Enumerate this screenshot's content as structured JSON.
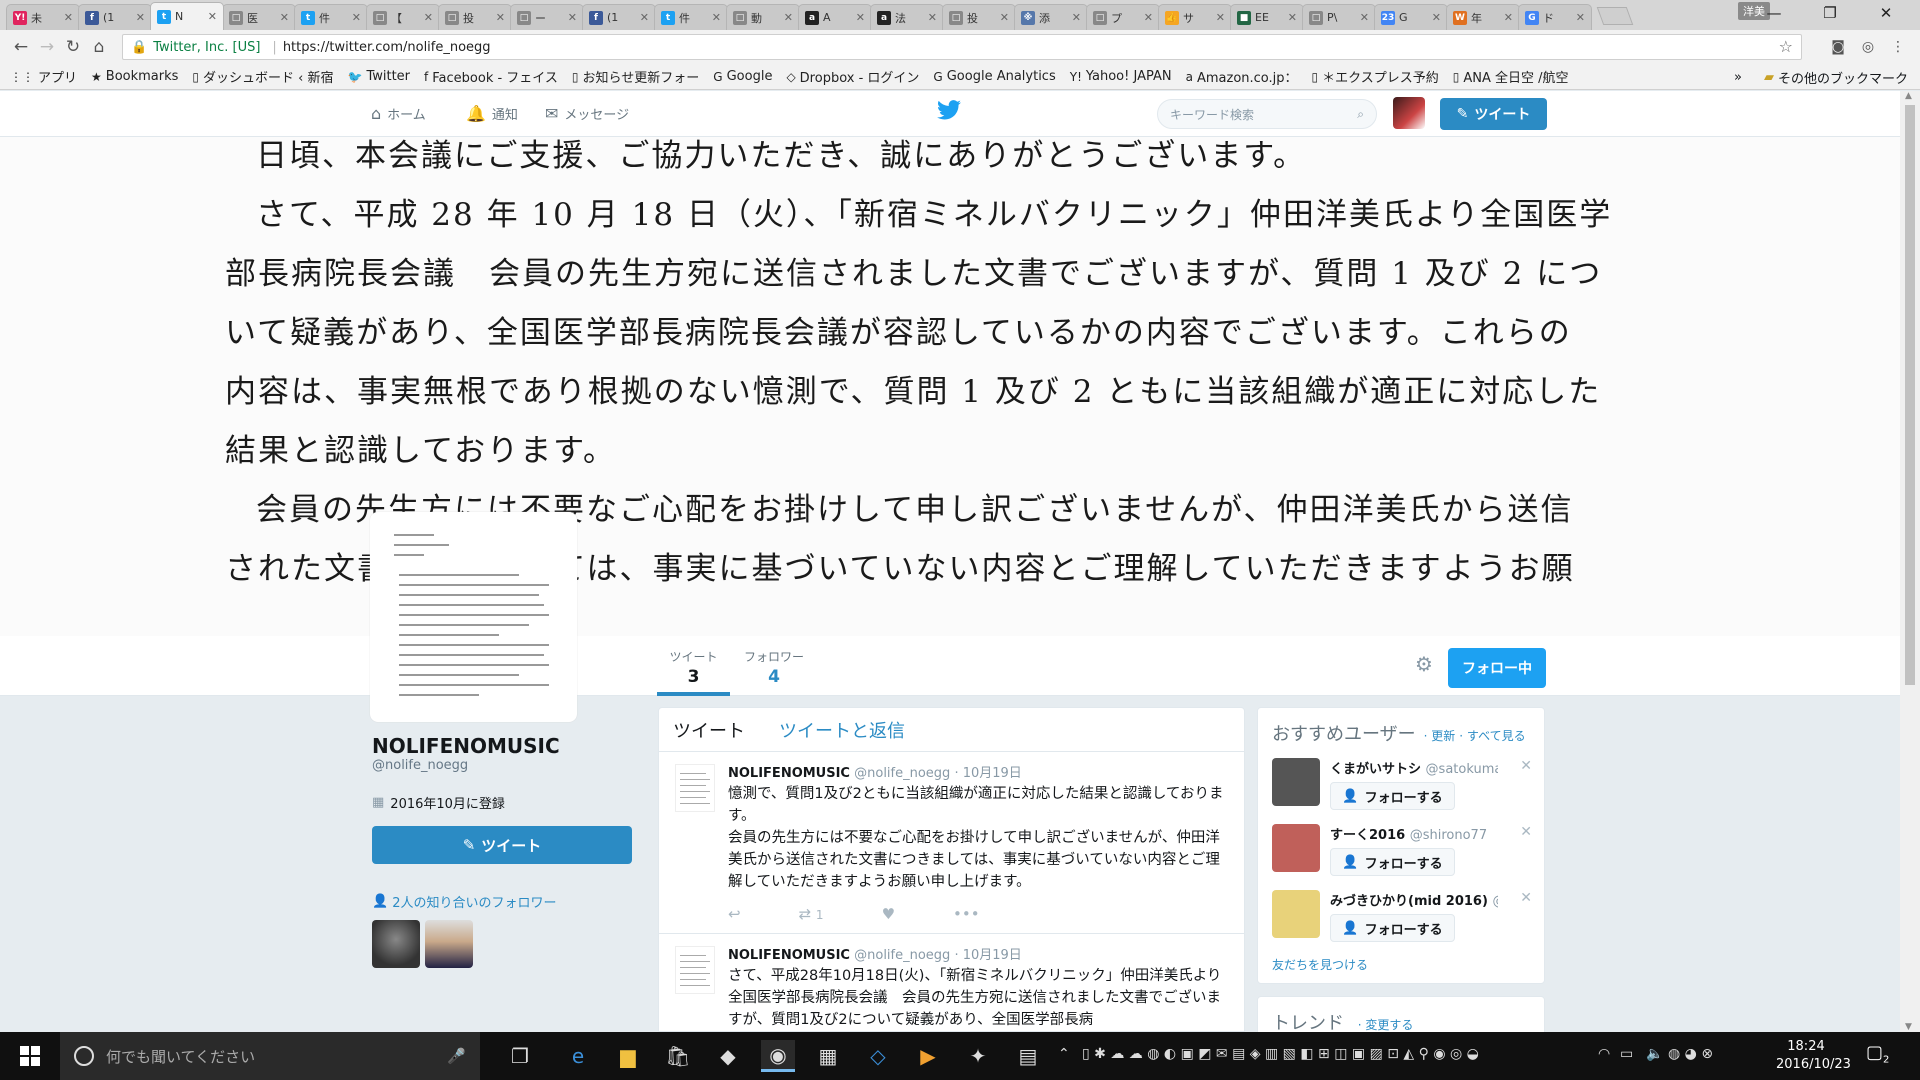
{
  "browser": {
    "tabs": [
      {
        "title": "未",
        "icon_text": "Y!",
        "color": "#e0245e"
      },
      {
        "title": "(1",
        "icon_text": "f",
        "color": "#3b5998"
      },
      {
        "title": "N",
        "icon_text": "t",
        "color": "#1da1f2",
        "active": true
      },
      {
        "title": "医",
        "icon_text": "□",
        "color": "#888888"
      },
      {
        "title": "件",
        "icon_text": "t",
        "color": "#1da1f2"
      },
      {
        "title": "【",
        "icon_text": "□",
        "color": "#888888"
      },
      {
        "title": "投",
        "icon_text": "□",
        "color": "#888888"
      },
      {
        "title": "ー",
        "icon_text": "□",
        "color": "#888888"
      },
      {
        "title": "(1",
        "icon_text": "f",
        "color": "#3b5998"
      },
      {
        "title": "件",
        "icon_text": "t",
        "color": "#1da1f2"
      },
      {
        "title": "動",
        "icon_text": "□",
        "color": "#888888"
      },
      {
        "title": "A",
        "icon_text": "a",
        "color": "#222222"
      },
      {
        "title": "法",
        "icon_text": "a",
        "color": "#222222"
      },
      {
        "title": "投",
        "icon_text": "□",
        "color": "#888888"
      },
      {
        "title": "添",
        "icon_text": "※",
        "color": "#5577aa"
      },
      {
        "title": "プ",
        "icon_text": "□",
        "color": "#888888"
      },
      {
        "title": "サ",
        "icon_text": "👍",
        "color": "#f5a623"
      },
      {
        "title": "EE",
        "icon_text": "■",
        "color": "#226644"
      },
      {
        "title": "P\\",
        "icon_text": "□",
        "color": "#888888"
      },
      {
        "title": "G",
        "icon_text": "23",
        "color": "#4285f4"
      },
      {
        "title": "年",
        "icon_text": "W",
        "color": "#e07020"
      },
      {
        "title": "ド",
        "icon_text": "G",
        "color": "#4285f4"
      }
    ],
    "badge": "洋美",
    "url_owner": "Twitter, Inc. [US]",
    "url": "https://twitter.com/nolife_noegg",
    "bookmarks": [
      {
        "label": "アプリ",
        "icon": "apps-icon"
      },
      {
        "label": "Bookmarks",
        "icon": "star-icon"
      },
      {
        "label": "ダッシュボード ‹ 新宿",
        "icon": "page-icon"
      },
      {
        "label": "Twitter",
        "icon": "twitter-icon"
      },
      {
        "label": "Facebook - フェイス",
        "icon": "facebook-icon"
      },
      {
        "label": "お知らせ更新フォー",
        "icon": "page-icon"
      },
      {
        "label": "Google",
        "icon": "google-icon"
      },
      {
        "label": "Dropbox - ログイン",
        "icon": "dropbox-icon"
      },
      {
        "label": "Google Analytics",
        "icon": "google-icon"
      },
      {
        "label": "Yahoo! JAPAN",
        "icon": "yahoo-icon"
      },
      {
        "label": "Amazon.co.jp：",
        "icon": "amazon-icon"
      },
      {
        "label": "＊エクスプレス予約",
        "icon": "page-icon"
      },
      {
        "label": "ANA 全日空 /航空",
        "icon": "page-icon"
      }
    ],
    "bookmarks_other": "その他のブックマーク"
  },
  "twitter_nav": {
    "home": "ホーム",
    "notifications": "通知",
    "messages": "メッセージ",
    "search_placeholder": "キーワード検索",
    "tweet_button": "ツイート"
  },
  "banner_text": [
    "日頃、本会議にご支援、ご協力いただき、誠にありがとうございます。",
    "さて、平成 28 年 10 月 18 日（火）、「新宿ミネルバクリニック」仲田洋美氏より全国医学",
    "部長病院長会議　会員の先生方宛に送信されました文書でございますが、質問 1 及び 2 につ",
    "いて疑義があり、全国医学部長病院長会議が容認しているかの内容でございます。これらの",
    "内容は、事実無根であり根拠のない憶測で、質問 1 及び 2 ともに当該組織が適正に対応した",
    "結果と認識しております。",
    "会員の先生方には不要なご心配をお掛けして申し訳ございませんが、仲田洋美氏から送信",
    "された文書につきましては、事実に基づいていない内容とご理解していただきますようお願"
  ],
  "profile_nav": {
    "tweets_label": "ツイート",
    "tweets_count": "3",
    "following_label": "フォロワー",
    "following_count": "4",
    "following_button": "フォロー中"
  },
  "profile": {
    "name": "NOLIFENOMUSIC",
    "handle": "@nolife_noegg",
    "joined": "2016年10月に登録",
    "tweet_button": "ツイート",
    "followers_you_know": "2人の知り合いのフォロワー"
  },
  "timeline": {
    "tab_tweets": "ツイート",
    "tab_replies": "ツイートと返信",
    "tweets": [
      {
        "name": "NOLIFENOMUSIC",
        "handle": "@nolife_noegg",
        "date": "· 10月19日",
        "body": "憶測で、質問1及び2ともに当該組織が適正に対応した結果と認識しております。\n会員の先生方には不要なご心配をお掛けして申し訳ございませんが、仲田洋美氏から送信された文書につきましては、事実に基づいていない内容とご理解していただきますようお願い申し上げます。",
        "retweets": "1"
      },
      {
        "name": "NOLIFENOMUSIC",
        "handle": "@nolife_noegg",
        "date": "· 10月19日",
        "body": "さて、平成28年10月18日(火)、「新宿ミネルバクリニック」仲田洋美氏より全国医学部長病院長会議　会員の先生方宛に送信されました文書でございますが、質問1及び2について疑義があり、全国医学部長病",
        "retweets": ""
      }
    ]
  },
  "who_to_follow": {
    "title": "おすすめユーザー",
    "refresh": "· 更新",
    "view_all": "· すべて見る",
    "users": [
      {
        "name": "くまがいサトシ",
        "handle": "@satokuma",
        "follow": "フォローする",
        "avatar_color": "#555555"
      },
      {
        "name": "すーく2016",
        "handle": "@shirono77",
        "follow": "フォローする",
        "avatar_color": "#c0605a"
      },
      {
        "name": "みづきひかり(mid 2016)",
        "handle": "@...",
        "follow": "フォローする",
        "avatar_color": "#e8d27a"
      }
    ],
    "find_friends": "友だちを見つける"
  },
  "trends": {
    "title": "トレンド",
    "change": "· 変更する"
  },
  "taskbar": {
    "search_placeholder": "何でも聞いてください",
    "time": "18:24",
    "date": "2016/10/23",
    "notification_count": "2"
  }
}
